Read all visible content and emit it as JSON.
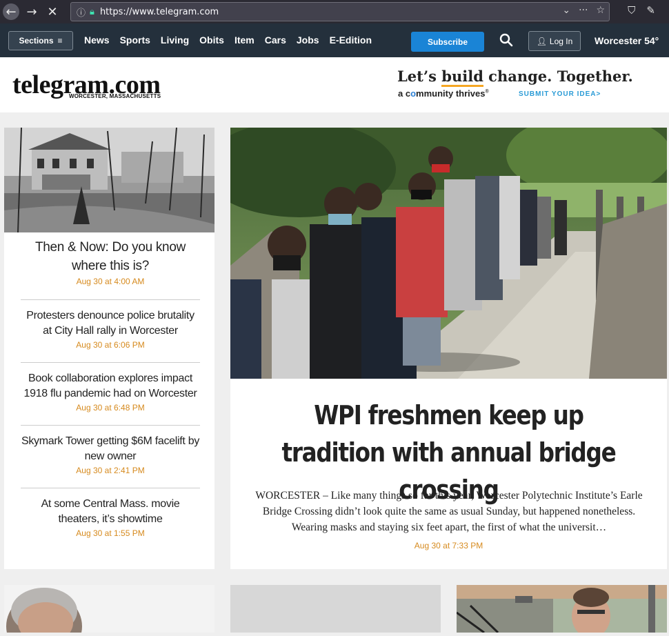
{
  "browser": {
    "url": "https://www.telegram.com",
    "back_icon": "arrow-left-icon",
    "forward_icon": "arrow-right-icon",
    "stop_icon": "close-icon"
  },
  "nav": {
    "sections_label": "Sections",
    "links": [
      "News",
      "Sports",
      "Living",
      "Obits",
      "Item",
      "Cars",
      "Jobs",
      "E-Edition"
    ],
    "subscribe_label": "Subscribe",
    "login_label": "Log In",
    "weather": "Worcester 54°"
  },
  "masthead": {
    "logo": "telegram.com",
    "logo_sub": "WORCESTER, MASSACHUSETTS",
    "ad_headline_pre": "Let’s ",
    "ad_headline_em": "build",
    "ad_headline_post": " change. Together.",
    "ad_sub_pre": "a c",
    "ad_sub_o": "o",
    "ad_sub_post": "mmunity thrives",
    "ad_sub_tm": "®",
    "ad_cta": "SUBMIT YOUR IDEA>"
  },
  "left_stories": [
    {
      "headline": "Then & Now: Do you know where this is?",
      "timestamp": "Aug 30 at 4:00 AM"
    },
    {
      "headline": "Protesters denounce police brutality at City Hall rally in Worcester",
      "timestamp": "Aug 30 at 6:06 PM"
    },
    {
      "headline": "Book collaboration explores impact 1918 flu pandemic had on Worcester",
      "timestamp": "Aug 30 at 6:48 PM"
    },
    {
      "headline": "Skymark Tower getting $6M facelift by new owner",
      "timestamp": "Aug 30 at 2:41 PM"
    },
    {
      "headline": "At some Central Mass. movie theaters, it’s showtime",
      "timestamp": "Aug 30 at 1:55 PM"
    }
  ],
  "main_story": {
    "headline": "WPI freshmen keep up tradition with annual bridge crossing",
    "summary": "WORCESTER – Like many things so far this year, Worcester Polytechnic Institute’s Earle Bridge Crossing didn’t look quite the same as usual Sunday, but happened nonetheless. Wearing masks and staying six feet apart, the first of what the universit…",
    "timestamp": "Aug 30 at 7:33 PM"
  },
  "colors": {
    "nav_bg": "#24303c",
    "accent_orange": "#d68a1e",
    "subscribe_blue": "#1a84d6"
  }
}
